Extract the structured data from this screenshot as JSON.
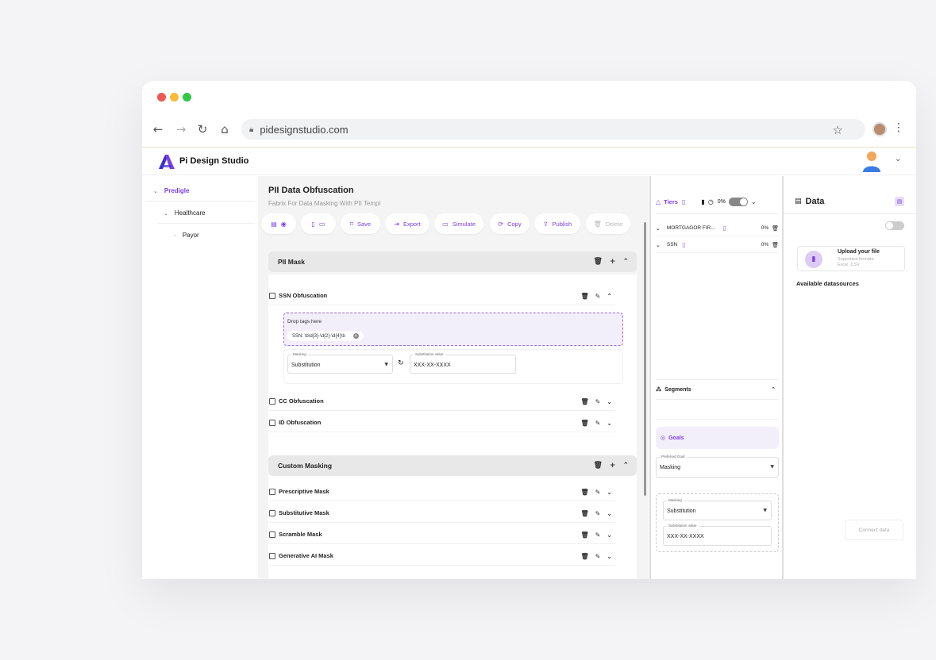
{
  "browser": {
    "url": "pidesignstudio.com",
    "traffic_lights": [
      "#ee5a52",
      "#f5bd3a",
      "#33c748"
    ]
  },
  "app": {
    "brand": "Pi Design Studio",
    "accent": "#7b3fe4"
  },
  "sidebar": {
    "items": [
      {
        "label": "Predigle",
        "level": 0,
        "expanded": true
      },
      {
        "label": "Healthcare",
        "level": 1,
        "expanded": true
      },
      {
        "label": "Payor",
        "level": 2,
        "expanded": false
      }
    ]
  },
  "main": {
    "title": "PII Data Obfuscation",
    "subtitle": "Fabrix For Data Masking With PII Templ",
    "toolbar": {
      "save": "Save",
      "export": "Export",
      "simulate": "Simulate",
      "copy": "Copy",
      "publish": "Publish",
      "delete": "Delete"
    },
    "pii_mask": {
      "title": "PII Mask",
      "rules": [
        {
          "label": "SSN Obfuscation",
          "expanded": true
        },
        {
          "label": "CC Obfuscation",
          "expanded": false
        },
        {
          "label": "ID Obfuscation",
          "expanded": false
        }
      ],
      "dropzone": {
        "label": "Drop tags here",
        "tag": "SSN: \\b\\d{3}-\\d{2}-\\d{4}\\b"
      },
      "masking": {
        "label": "Masking",
        "value": "Substitution"
      },
      "substitution": {
        "label": "Substitution value",
        "value": "XXX-XX-XXXX"
      }
    },
    "custom_masking": {
      "title": "Custom Masking",
      "rules": [
        {
          "label": "Prescriptive Mask"
        },
        {
          "label": "Substitutive Mask"
        },
        {
          "label": "Scramble Mask"
        },
        {
          "label": "Generative AI Mask"
        }
      ]
    }
  },
  "tiers_panel": {
    "title": "Tiers",
    "percent": "0%",
    "rows": [
      {
        "label": "MORTGAGOR FIR...",
        "percent": "0%"
      },
      {
        "label": "SSN",
        "percent": "0%"
      }
    ],
    "segments": "Segments",
    "goals": "Goals",
    "preferred_goal": {
      "label": "Preferred Goal",
      "value": "Masking"
    },
    "masking": {
      "label": "Masking",
      "value": "Substitution"
    },
    "substitution": {
      "label": "Substitution value",
      "value": "XXX-XX-XXXX"
    }
  },
  "data_panel": {
    "title": "Data",
    "upload_title": "Upload your file",
    "upload_formats": "Supported formats:",
    "upload_types": "Excel, CSV",
    "available": "Available datasources",
    "connect": "Connect data"
  }
}
